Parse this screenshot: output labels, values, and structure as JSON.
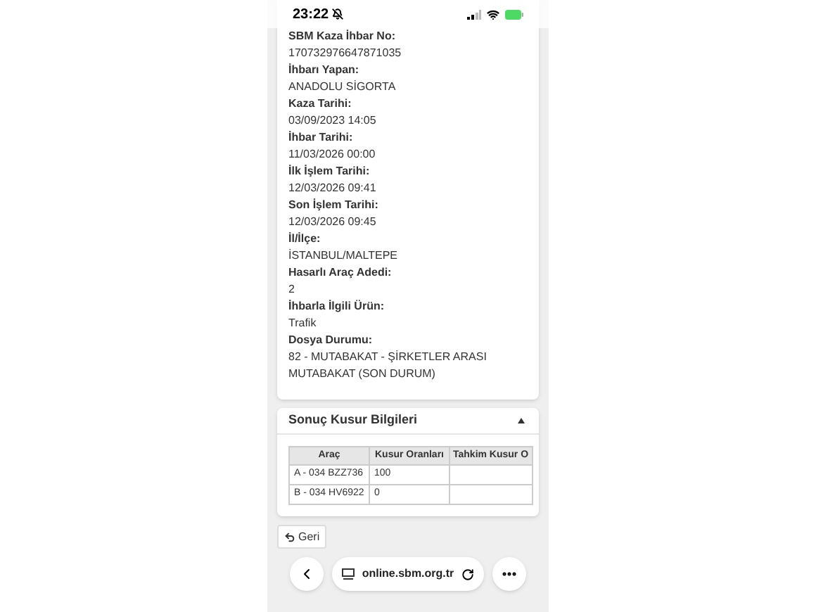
{
  "status_bar": {
    "time": "23:22"
  },
  "details": [
    {
      "label": "SBM Kaza İhbar No:",
      "value": "170732976647871035"
    },
    {
      "label": "İhbarı Yapan:",
      "value": "ANADOLU SİGORTA"
    },
    {
      "label": "Kaza Tarihi:",
      "value": "03/09/2023 14:05"
    },
    {
      "label": "İhbar Tarihi:",
      "value": "11/03/2026 00:00"
    },
    {
      "label": "İlk İşlem Tarihi:",
      "value": "12/03/2026 09:41"
    },
    {
      "label": "Son İşlem Tarihi:",
      "value": "12/03/2026 09:45"
    },
    {
      "label": "İl/İlçe:",
      "value": "İSTANBUL/MALTEPE"
    },
    {
      "label": "Hasarlı Araç Adedi:",
      "value": "2"
    },
    {
      "label": "İhbarla İlgili Ürün:",
      "value": "Trafik"
    },
    {
      "label": "Dosya Durumu:",
      "value": "82 - MUTABAKAT - ŞİRKETLER ARASI MUTABAKAT (SON DURUM)"
    }
  ],
  "result_panel": {
    "title": "Sonuç Kusur Bilgileri",
    "expanded": true,
    "columns": [
      "Araç",
      "Kusur Oranları",
      "Tahkim Kusur O"
    ],
    "rows": [
      [
        "A - 034 BZZ736",
        "100",
        ""
      ],
      [
        "B - 034 HV6922",
        "0",
        ""
      ]
    ]
  },
  "back_button": "Geri",
  "browser_bar": {
    "url": "online.sbm.org.tr"
  }
}
